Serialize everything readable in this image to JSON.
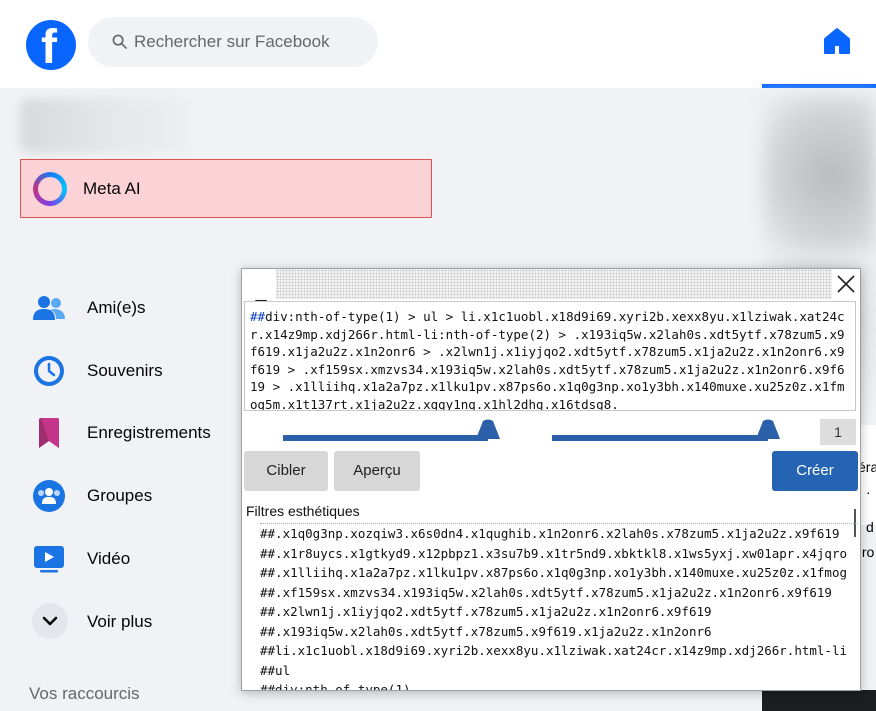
{
  "header": {
    "logo_letter": "f",
    "search_placeholder": "Rechercher sur Facebook"
  },
  "sidebar": {
    "meta_ai_label": "Meta AI",
    "items": [
      {
        "label": "Ami(e)s",
        "icon": "friends-icon"
      },
      {
        "label": "Souvenirs",
        "icon": "memories-clock-icon"
      },
      {
        "label": "Enregistrements",
        "icon": "bookmark-icon"
      },
      {
        "label": "Groupes",
        "icon": "groups-icon"
      },
      {
        "label": "Vidéo",
        "icon": "video-icon"
      },
      {
        "label": "Voir plus",
        "icon": "chevron-down-icon"
      }
    ],
    "shortcuts_title": "Vos raccourcis"
  },
  "right_panel": {
    "snippets": [
      "éra",
      "·",
      "d",
      "ıro"
    ]
  },
  "dialog": {
    "minimize_label": "_",
    "selector_prefix": "##",
    "selector_text": "div:nth-of-type(1) > ul > li.x1c1uobl.x18d9i69.xyri2b.xexx8yu.x1lziwak.xat24cr.x14z9mp.xdj266r.html-li:nth-of-type(2) > .x193iq5w.x2lah0s.xdt5ytf.x78zum5.x9f619.x1ja2u2z.x1n2onr6 > .x2lwn1j.x1iyjqo2.xdt5ytf.x78zum5.x1ja2u2z.x1n2onr6.x9f619 > .xf159sx.xmzvs34.x193iq5w.x2lah0s.xdt5ytf.x78zum5.x1ja2u2z.x1n2onr6.x9f619 > .x1lliihq.x1a2a7pz.x1lku1pv.x87ps6o.x1q0g3np.xo1y3bh.x140muxe.xu25z0z.x1fmog5m.x1t137rt.x1ja2u2z.xggy1nq.x1hl2dhg.x16tdsg8.",
    "slider1_value": 0.87,
    "slider2_value": 0.85,
    "counter": "1",
    "buttons": {
      "target": "Cibler",
      "preview": "Aperçu",
      "create": "Créer"
    },
    "filters_title": "Filtres esthétiques",
    "filters": [
      "##.x1q0g3np.xozqiw3.x6s0dn4.x1qughib.x1n2onr6.x2lah0s.x78zum5.x1ja2u2z.x9f619",
      "##.x1r8uycs.x1gtkyd9.x12pbpz1.x3su7b9.x1tr5nd9.xbktkl8.x1ws5yxj.xw01apr.x4jqro",
      "##.x1lliihq.x1a2a7pz.x1lku1pv.x87ps6o.x1q0g3np.xo1y3bh.x140muxe.xu25z0z.x1fmog",
      "##.xf159sx.xmzvs34.x193iq5w.x2lah0s.xdt5ytf.x78zum5.x1ja2u2z.x1n2onr6.x9f619",
      "##.x2lwn1j.x1iyjqo2.xdt5ytf.x78zum5.x1ja2u2z.x1n2onr6.x9f619",
      "##.x193iq5w.x2lah0s.xdt5ytf.x78zum5.x9f619.x1ja2u2z.x1n2onr6",
      "##li.x1c1uobl.x18d9i69.xyri2b.xexx8yu.x1lziwak.xat24cr.x14z9mp.xdj266r.html-li",
      "##ul",
      "##div:nth-of-type(1)"
    ]
  },
  "colors": {
    "fb_blue": "#0866ff",
    "meta_ai_bg": "#fbd3d7",
    "create_button": "#2563b3",
    "slider": "#2b5fa8"
  }
}
